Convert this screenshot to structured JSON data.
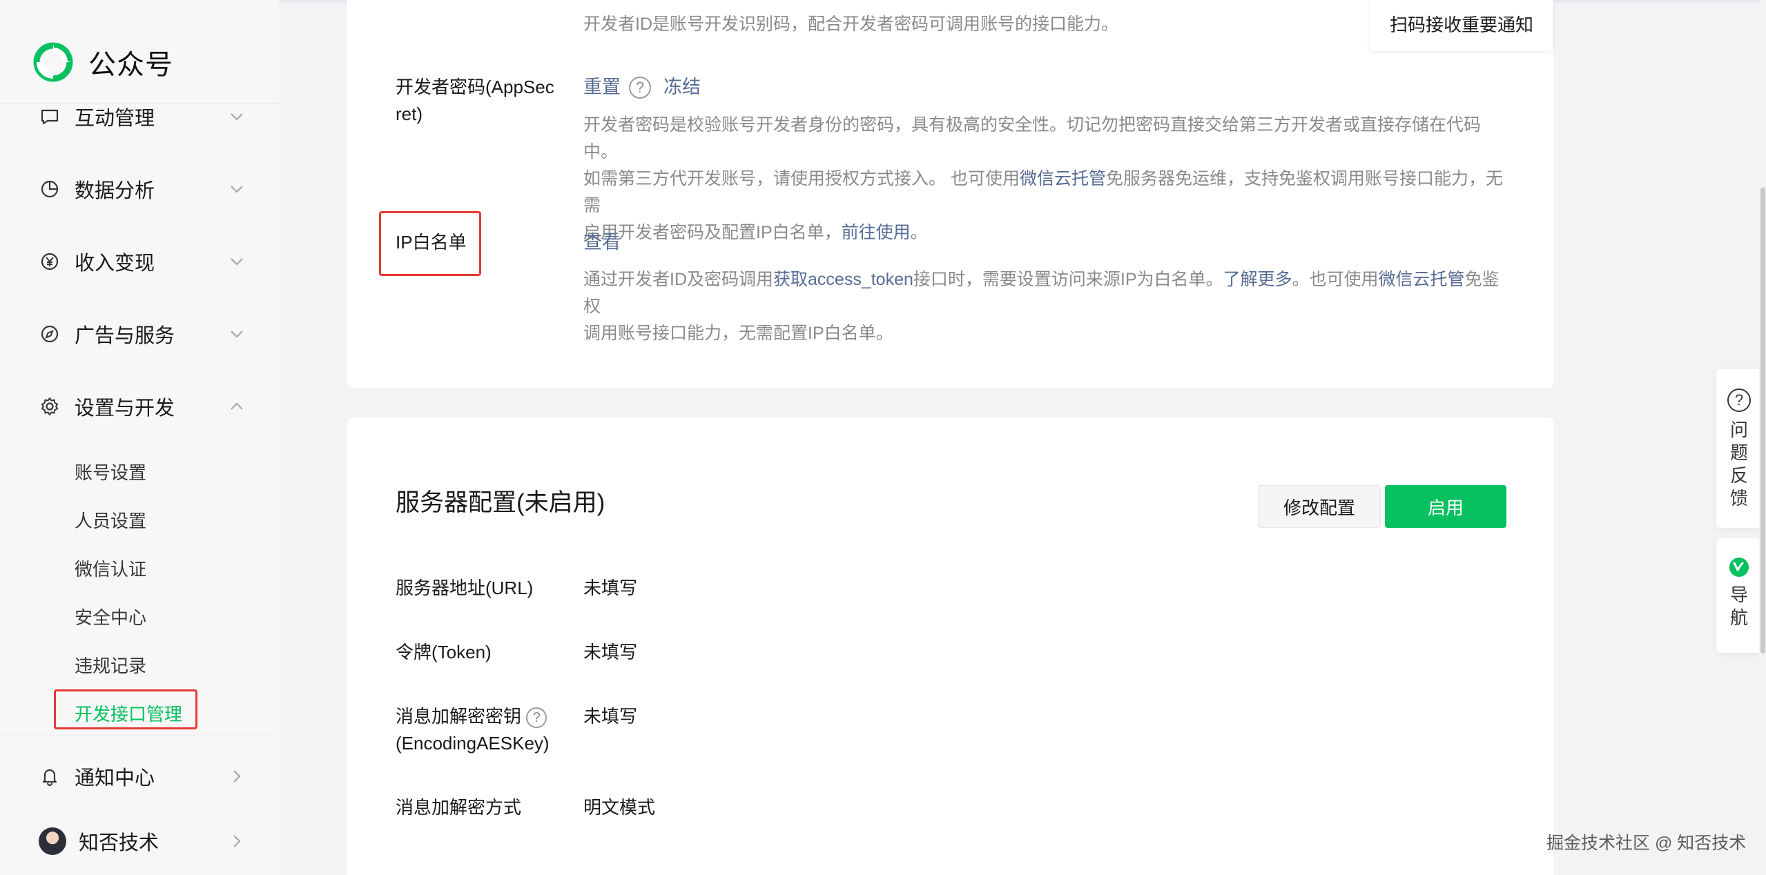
{
  "app": {
    "name": "公众号"
  },
  "sidebar": {
    "items": [
      {
        "label": "互动管理",
        "icon": "chat-bubble-icon"
      },
      {
        "label": "数据分析",
        "icon": "pie-chart-icon"
      },
      {
        "label": "收入变现",
        "icon": "yen-coin-icon"
      },
      {
        "label": "广告与服务",
        "icon": "compass-icon"
      },
      {
        "label": "设置与开发",
        "icon": "gear-icon"
      }
    ],
    "subitems": [
      "账号设置",
      "人员设置",
      "微信认证",
      "安全中心",
      "违规记录",
      "开发接口管理"
    ],
    "active_subitem": "开发接口管理",
    "notification": {
      "label": "通知中心",
      "icon": "bell-icon"
    },
    "account": {
      "label": "知否技术"
    }
  },
  "developer": {
    "appid_desc": "开发者ID是账号开发识别码，配合开发者密码可调用账号的接口能力。",
    "notify_button": "扫码接收重要通知",
    "secret": {
      "label_line1": "开发者密码(AppSec",
      "label_line2": "ret)",
      "reset": "重置",
      "freeze": "冻结",
      "desc_line1": "开发者密码是校验账号开发者身份的密码，具有极高的安全性。切记勿把密码直接交给第三方开发者或直接存储在代码中。",
      "desc_line2_a": "如需第三方代开发账号，请使用授权方式接入。 也可使用",
      "desc_line2_link": "微信云托管",
      "desc_line2_b": "免服务器免运维，支持免鉴权调用账号接口能力，无需",
      "desc_line3_a": "启用开发者密码及配置IP白名单，",
      "desc_line3_link": "前往使用",
      "desc_line3_b": "。"
    },
    "ip_whitelist": {
      "label": "IP白名单",
      "view": "查看",
      "desc_line1_a": "通过开发者ID及密码调用",
      "desc_line1_link1": "获取access_token",
      "desc_line1_b": "接口时，需要设置访问来源IP为白名单。",
      "desc_line1_link2": "了解更多",
      "desc_line1_c": "。也可使用",
      "desc_line1_link3": "微信云托管",
      "desc_line1_d": "免鉴权",
      "desc_line2": "调用账号接口能力，无需配置IP白名单。"
    }
  },
  "server_config": {
    "title": "服务器配置(未启用)",
    "modify_button": "修改配置",
    "enable_button": "启用",
    "rows": [
      {
        "label": "服务器地址(URL)",
        "value": "未填写"
      },
      {
        "label": "令牌(Token)",
        "value": "未填写"
      },
      {
        "label_line1": "消息加解密密钥",
        "label_line2": "(EncodingAESKey)",
        "value": "未填写"
      },
      {
        "label": "消息加解密方式",
        "value": "明文模式"
      }
    ]
  },
  "float": {
    "feedback": [
      "问",
      "题",
      "反",
      "馈"
    ],
    "guide": [
      "导",
      "航"
    ]
  },
  "watermark": "掘金技术社区 @ 知否技术",
  "colors": {
    "brand_green": "#07c160",
    "link": "#576b95",
    "highlight_red": "#e53935"
  }
}
